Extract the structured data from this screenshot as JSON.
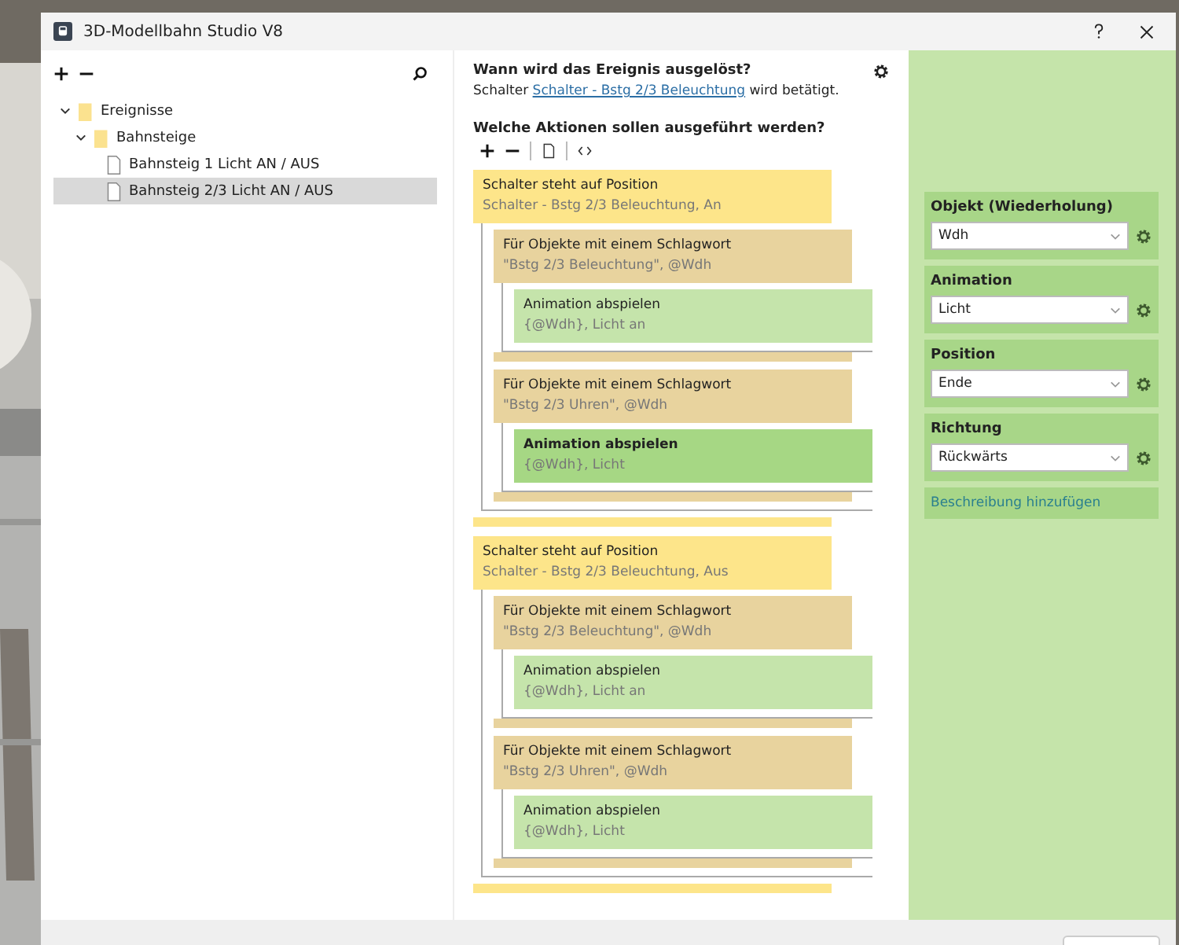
{
  "window": {
    "title": "3D-Modellbahn Studio V8"
  },
  "tree": [
    {
      "label": "Ereignisse",
      "kind": "folder",
      "expanded": true,
      "selected": false,
      "children": [
        {
          "label": "Bahnsteige",
          "kind": "folder",
          "expanded": true,
          "selected": false,
          "children": [
            {
              "label": "Bahnsteig 1 Licht AN / AUS",
              "kind": "file",
              "selected": false
            },
            {
              "label": "Bahnsteig 2/3 Licht AN / AUS",
              "kind": "file",
              "selected": true
            }
          ]
        }
      ]
    }
  ],
  "trigger": {
    "question": "Wann wird das Ereignis ausgelöst?",
    "prefix": "Schalter",
    "link": "Schalter - Bstg 2/3 Beleuchtung",
    "suffix": "wird betätigt."
  },
  "actions_heading": "Welche Aktionen sollen ausgeführt werden?",
  "actions": [
    {
      "kind": "condition",
      "title": "Schalter steht auf Position",
      "detail": "Schalter - Bstg 2/3 Beleuchtung, An",
      "selected": false,
      "children": [
        {
          "kind": "loop",
          "title": "Für Objekte mit einem Schlagwort",
          "detail": "\"Bstg 2/3 Beleuchtung\", @Wdh",
          "selected": false,
          "children": [
            {
              "kind": "action",
              "title": "Animation abspielen",
              "detail": "{@Wdh}, Licht an",
              "selected": false
            }
          ]
        },
        {
          "kind": "loop",
          "title": "Für Objekte mit einem Schlagwort",
          "detail": "\"Bstg 2/3 Uhren\", @Wdh",
          "selected": false,
          "children": [
            {
              "kind": "action",
              "title": "Animation abspielen",
              "detail": "{@Wdh}, Licht",
              "selected": true
            }
          ]
        }
      ]
    },
    {
      "kind": "condition",
      "title": "Schalter steht auf Position",
      "detail": "Schalter - Bstg 2/3 Beleuchtung, Aus",
      "selected": false,
      "children": [
        {
          "kind": "loop",
          "title": "Für Objekte mit einem Schlagwort",
          "detail": "\"Bstg 2/3 Beleuchtung\", @Wdh",
          "selected": false,
          "children": [
            {
              "kind": "action",
              "title": "Animation abspielen",
              "detail": "{@Wdh}, Licht an",
              "selected": false
            }
          ]
        },
        {
          "kind": "loop",
          "title": "Für Objekte mit einem Schlagwort",
          "detail": "\"Bstg 2/3 Uhren\", @Wdh",
          "selected": false,
          "children": [
            {
              "kind": "action",
              "title": "Animation abspielen",
              "detail": "{@Wdh}, Licht",
              "selected": false
            }
          ]
        }
      ]
    }
  ],
  "properties": [
    {
      "label": "Objekt (Wiederholung)",
      "value": "Wdh"
    },
    {
      "label": "Animation",
      "value": "Licht"
    },
    {
      "label": "Position",
      "value": "Ende"
    },
    {
      "label": "Richtung",
      "value": "Rückwärts"
    }
  ],
  "description_link": "Beschreibung hinzufügen"
}
